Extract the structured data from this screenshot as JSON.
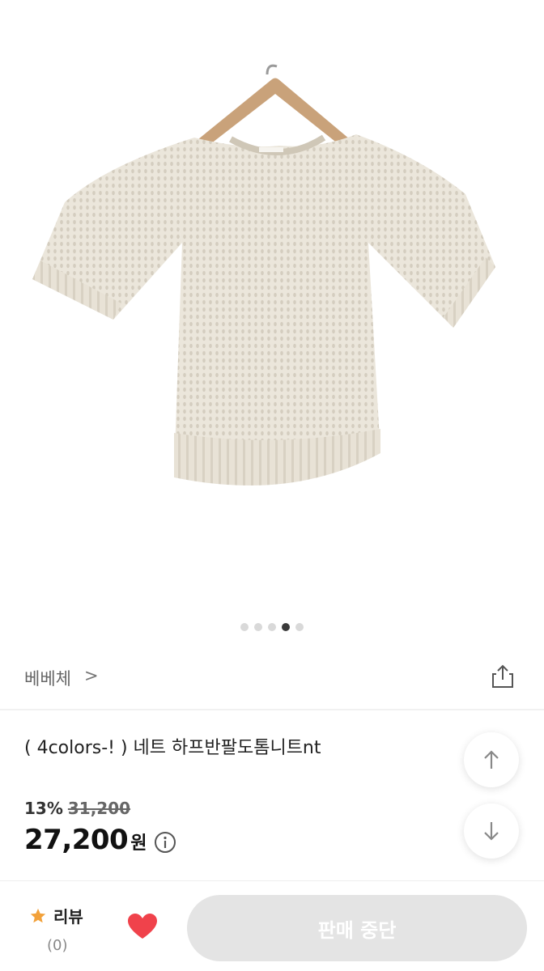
{
  "gallery": {
    "image_alt": "beige short sleeve knit sweater on hanger",
    "dot_count": 5,
    "active_index": 3
  },
  "shop": {
    "name": "베베체",
    "chevron": ">"
  },
  "product": {
    "title": "( 4colors-! ) 네트 하프반팔도톰니트nt",
    "discount": "13%",
    "original_price": "31,200",
    "price": "27,200",
    "currency": "원"
  },
  "footer": {
    "review_label": "리뷰",
    "review_count": "(0)",
    "action_label": "판매 중단"
  },
  "colors": {
    "accent_star": "#f2a13a",
    "heart": "#f0424b",
    "disabled_button": "#e4e4e4"
  }
}
